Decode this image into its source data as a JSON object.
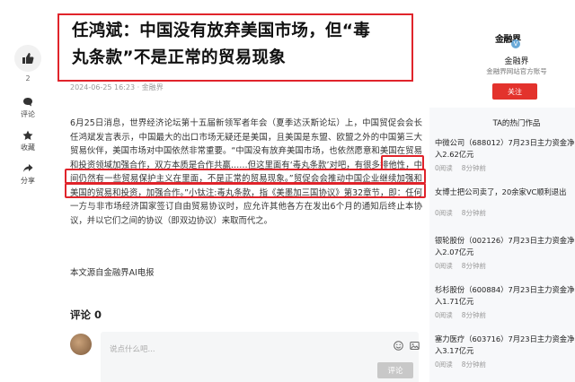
{
  "rail": {
    "like_count": "2",
    "comment_label": "评论",
    "collect_label": "收藏",
    "share_label": "分享"
  },
  "article": {
    "title_line1": "任鸿斌：中国没有放弃美国市场，但“毒",
    "title_line2": "丸条款”不是正常的贸易现象",
    "meta": "2024-06-25 16:23 · 金融界",
    "body": "6月25日消息，世界经济论坛第十五届新领军者年会（夏季达沃斯论坛）上，中国贸促会会长任鸿斌发言表示，中国最大的出口市场无疑还是美国，且美国是东盟、欧盟之外的中国第三大贸易伙伴，美国市场对中国依然非常重要。“中国没有放弃美国市场，也依然愿意和美国在贸易和投资领域加强合作，双方本质是合作共赢……但这里面有‘毒丸条款’对吧，有很多排他性，中间仍然有一些贸易保护主义在里面，不是正常的贸易现象。”贸促会会推动中国企业继续加强和美国的贸易和投资，加强合作。”小钛注:毒丸条款，指《美墨加三国协议》第32章节，即：任何一方与非市场经济国家签订自由贸易协议时，应允许其他各方在发出6个月的通知后终止本协议，并以它们之间的协议（即双边协议）来取而代之。",
    "source": "本文源自金融界AI电报"
  },
  "comments": {
    "title": "评论 0",
    "placeholder": "说点什么吧...",
    "submit_label": "评论"
  },
  "sidebar": {
    "logo_text": "金融界",
    "verify_mark": "V",
    "account_name": "金融界",
    "account_desc": "金融界网站官方账号",
    "follow_label": "关注",
    "hot_title": "TA的热门作品",
    "hot_items": [
      {
        "line1": "中微公司（688012）7月23日主力资金净",
        "line2": "入2.62亿元",
        "views": "0阅读",
        "time": "8分钟前"
      },
      {
        "line1": "女博士把公司卖了，20余家VC顺利退出",
        "line2": "",
        "views": "0阅读",
        "time": "8分钟前"
      },
      {
        "line1": "银轮股份（002126）7月23日主力资金净",
        "line2": "入2.07亿元",
        "views": "0阅读",
        "time": "8分钟前"
      },
      {
        "line1": "杉杉股份（600884）7月23日主力资金净",
        "line2": "入1.71亿元",
        "views": "0阅读",
        "time": "8分钟前"
      },
      {
        "line1": "塞力医疗（603716）7月23日主力资金净",
        "line2": "入3.17亿元",
        "views": "0阅读",
        "time": "8分钟前"
      }
    ]
  },
  "colors": {
    "accent_red": "#e0242b",
    "follow_red": "#e3322c",
    "verify_blue": "#6aa9d8"
  }
}
